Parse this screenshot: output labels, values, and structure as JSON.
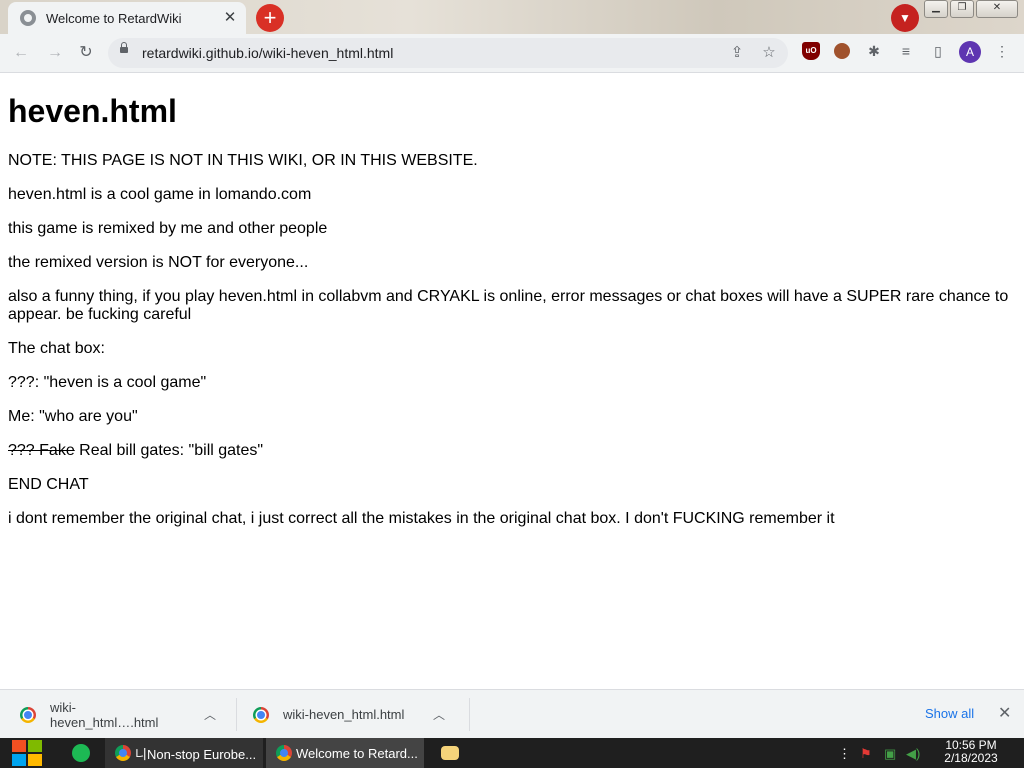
{
  "browser": {
    "tab_title": "Welcome to RetardWiki",
    "tab_close": "✕",
    "new_tab": "+",
    "url": "retardwiki.github.io/wiki-heven_html.html",
    "profile_initial": "A"
  },
  "window_controls": {
    "minimize": "▁",
    "restore": "❐",
    "close": "✕"
  },
  "page": {
    "title": "heven.html",
    "paragraphs": {
      "p0": "NOTE: THIS PAGE IS NOT IN THIS WIKI, OR IN THIS WEBSITE.",
      "p1": "heven.html is a cool game in lomando.com",
      "p2": "this game is remixed by me and other people",
      "p3": "the remixed version is NOT for everyone...",
      "p4a": "also a funny thing, if you play heven.html in collabvm and CRYAKL is online, error messages or chat boxes will have a SUPER rare chance to",
      "p4b": "appear. be fucking careful",
      "p5": "The chat box:",
      "p6": "???: \"heven is a cool game\"",
      "p7": "Me: \"who are you\"",
      "p8_strike": "??? Fake",
      "p8_rest": " Real bill gates: \"bill gates\"",
      "p9": "END CHAT",
      "p10": "i dont remember the original chat, i just correct all the mistakes in the original chat box. I don't FUCKING remember it"
    }
  },
  "downloads": {
    "items": [
      {
        "name": "wiki-heven_html….html"
      },
      {
        "name": "wiki-heven_html.html"
      }
    ],
    "show_all": "Show all",
    "close": "✕"
  },
  "taskbar": {
    "tasks": [
      {
        "label": "니Non-stop Eurobe..."
      },
      {
        "label": "Welcome to Retard..."
      }
    ],
    "time": "10:56 PM",
    "date": "2/18/2023"
  }
}
